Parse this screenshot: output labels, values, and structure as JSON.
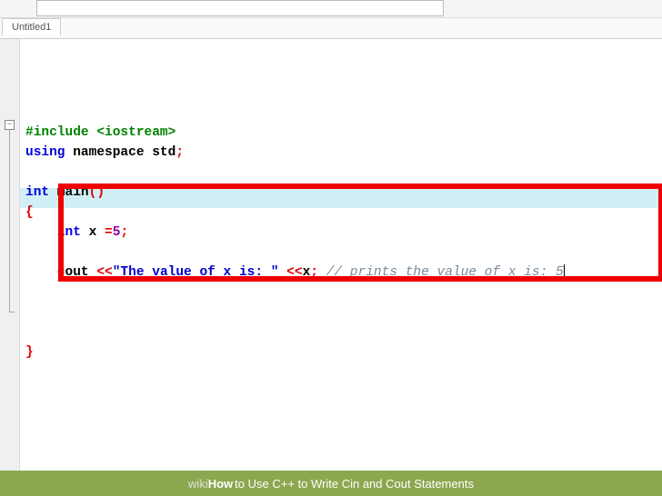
{
  "tab": {
    "label": "Untitled1"
  },
  "code": {
    "line1_include": "#include <iostream>",
    "line2_using": "using",
    "line2_namespace": " namespace",
    "line2_std": " std",
    "line2_semi": ";",
    "line4_int": "int",
    "line4_main": " main",
    "line4_paren": "()",
    "line5_brace": "{",
    "line6_indent": "    ",
    "line6_int": "int",
    "line6_var": " x ",
    "line6_eq": "=",
    "line6_val": "5",
    "line6_semi": ";",
    "line8_indent": "    ",
    "line8_cout": "cout ",
    "line8_op1": "<<",
    "line8_str": "\"The value of x is: \"",
    "line8_op2": " <<",
    "line8_x": "x",
    "line8_semi": ";",
    "line8_comment": " // prints the value of x is: 5",
    "line12_brace": "}"
  },
  "fold": {
    "symbol": "−"
  },
  "watermark": {
    "wiki": "wiki",
    "how": "How",
    "title": " to Use C++ to Write Cin and Cout Statements"
  }
}
